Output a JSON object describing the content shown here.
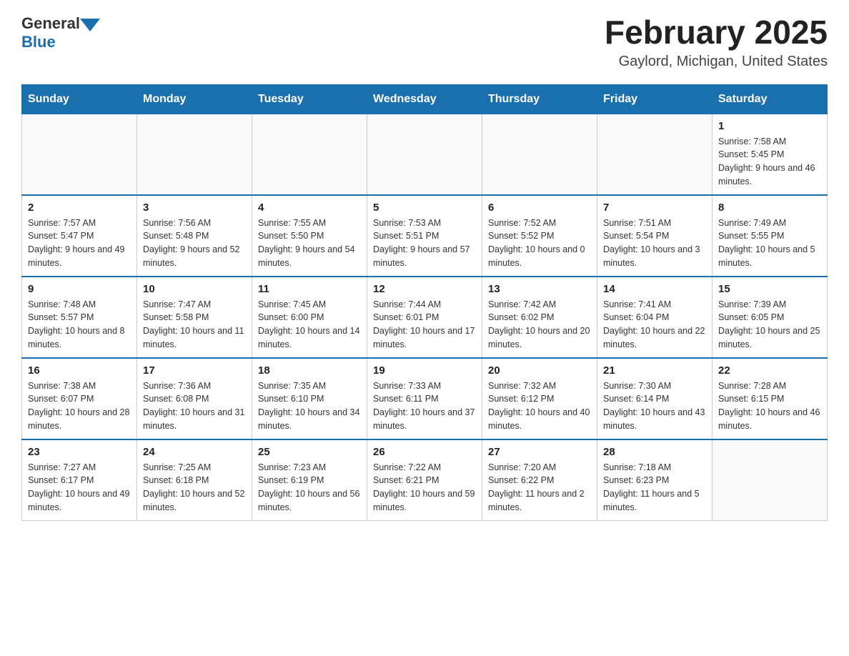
{
  "header": {
    "logo_general": "General",
    "logo_blue": "Blue",
    "title": "February 2025",
    "subtitle": "Gaylord, Michigan, United States"
  },
  "days_of_week": [
    "Sunday",
    "Monday",
    "Tuesday",
    "Wednesday",
    "Thursday",
    "Friday",
    "Saturday"
  ],
  "weeks": [
    [
      {
        "day": "",
        "info": ""
      },
      {
        "day": "",
        "info": ""
      },
      {
        "day": "",
        "info": ""
      },
      {
        "day": "",
        "info": ""
      },
      {
        "day": "",
        "info": ""
      },
      {
        "day": "",
        "info": ""
      },
      {
        "day": "1",
        "info": "Sunrise: 7:58 AM\nSunset: 5:45 PM\nDaylight: 9 hours and 46 minutes."
      }
    ],
    [
      {
        "day": "2",
        "info": "Sunrise: 7:57 AM\nSunset: 5:47 PM\nDaylight: 9 hours and 49 minutes."
      },
      {
        "day": "3",
        "info": "Sunrise: 7:56 AM\nSunset: 5:48 PM\nDaylight: 9 hours and 52 minutes."
      },
      {
        "day": "4",
        "info": "Sunrise: 7:55 AM\nSunset: 5:50 PM\nDaylight: 9 hours and 54 minutes."
      },
      {
        "day": "5",
        "info": "Sunrise: 7:53 AM\nSunset: 5:51 PM\nDaylight: 9 hours and 57 minutes."
      },
      {
        "day": "6",
        "info": "Sunrise: 7:52 AM\nSunset: 5:52 PM\nDaylight: 10 hours and 0 minutes."
      },
      {
        "day": "7",
        "info": "Sunrise: 7:51 AM\nSunset: 5:54 PM\nDaylight: 10 hours and 3 minutes."
      },
      {
        "day": "8",
        "info": "Sunrise: 7:49 AM\nSunset: 5:55 PM\nDaylight: 10 hours and 5 minutes."
      }
    ],
    [
      {
        "day": "9",
        "info": "Sunrise: 7:48 AM\nSunset: 5:57 PM\nDaylight: 10 hours and 8 minutes."
      },
      {
        "day": "10",
        "info": "Sunrise: 7:47 AM\nSunset: 5:58 PM\nDaylight: 10 hours and 11 minutes."
      },
      {
        "day": "11",
        "info": "Sunrise: 7:45 AM\nSunset: 6:00 PM\nDaylight: 10 hours and 14 minutes."
      },
      {
        "day": "12",
        "info": "Sunrise: 7:44 AM\nSunset: 6:01 PM\nDaylight: 10 hours and 17 minutes."
      },
      {
        "day": "13",
        "info": "Sunrise: 7:42 AM\nSunset: 6:02 PM\nDaylight: 10 hours and 20 minutes."
      },
      {
        "day": "14",
        "info": "Sunrise: 7:41 AM\nSunset: 6:04 PM\nDaylight: 10 hours and 22 minutes."
      },
      {
        "day": "15",
        "info": "Sunrise: 7:39 AM\nSunset: 6:05 PM\nDaylight: 10 hours and 25 minutes."
      }
    ],
    [
      {
        "day": "16",
        "info": "Sunrise: 7:38 AM\nSunset: 6:07 PM\nDaylight: 10 hours and 28 minutes."
      },
      {
        "day": "17",
        "info": "Sunrise: 7:36 AM\nSunset: 6:08 PM\nDaylight: 10 hours and 31 minutes."
      },
      {
        "day": "18",
        "info": "Sunrise: 7:35 AM\nSunset: 6:10 PM\nDaylight: 10 hours and 34 minutes."
      },
      {
        "day": "19",
        "info": "Sunrise: 7:33 AM\nSunset: 6:11 PM\nDaylight: 10 hours and 37 minutes."
      },
      {
        "day": "20",
        "info": "Sunrise: 7:32 AM\nSunset: 6:12 PM\nDaylight: 10 hours and 40 minutes."
      },
      {
        "day": "21",
        "info": "Sunrise: 7:30 AM\nSunset: 6:14 PM\nDaylight: 10 hours and 43 minutes."
      },
      {
        "day": "22",
        "info": "Sunrise: 7:28 AM\nSunset: 6:15 PM\nDaylight: 10 hours and 46 minutes."
      }
    ],
    [
      {
        "day": "23",
        "info": "Sunrise: 7:27 AM\nSunset: 6:17 PM\nDaylight: 10 hours and 49 minutes."
      },
      {
        "day": "24",
        "info": "Sunrise: 7:25 AM\nSunset: 6:18 PM\nDaylight: 10 hours and 52 minutes."
      },
      {
        "day": "25",
        "info": "Sunrise: 7:23 AM\nSunset: 6:19 PM\nDaylight: 10 hours and 56 minutes."
      },
      {
        "day": "26",
        "info": "Sunrise: 7:22 AM\nSunset: 6:21 PM\nDaylight: 10 hours and 59 minutes."
      },
      {
        "day": "27",
        "info": "Sunrise: 7:20 AM\nSunset: 6:22 PM\nDaylight: 11 hours and 2 minutes."
      },
      {
        "day": "28",
        "info": "Sunrise: 7:18 AM\nSunset: 6:23 PM\nDaylight: 11 hours and 5 minutes."
      },
      {
        "day": "",
        "info": ""
      }
    ]
  ],
  "accent_color": "#1a6fad"
}
